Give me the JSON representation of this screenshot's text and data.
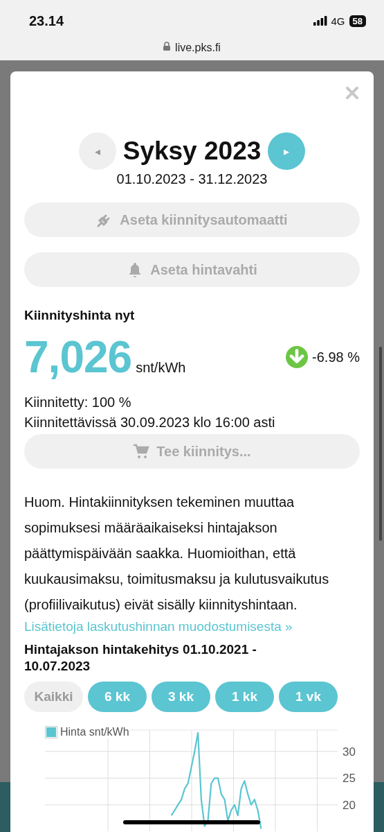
{
  "status_bar": {
    "time": "23.14",
    "network": "4G",
    "battery": "58"
  },
  "address_bar": {
    "url": "live.pks.fi"
  },
  "modal": {
    "period": {
      "title": "Syksy 2023",
      "dates": "01.10.2023 - 31.12.2023",
      "prev": {
        "label": "◂",
        "disabled": true
      },
      "next": {
        "label": "▸",
        "disabled": false
      }
    },
    "actions": [
      {
        "kind": "plug",
        "label": "Aseta kiinnitysautomaatti",
        "disabled": true
      },
      {
        "kind": "bell",
        "label": "Aseta hintavahti",
        "disabled": true
      }
    ],
    "price": {
      "heading": "Kiinnityshinta nyt",
      "value": "7,026",
      "unit": "snt/kWh",
      "decreasing": true,
      "change": "-6.98 %"
    },
    "fixed": "Kiinnitetty: 100 %",
    "deadline": "Kiinnitettävissä 30.09.2023 klo 16:00 asti",
    "order_button": {
      "kind": "cart",
      "label": "Tee kiinnitys...",
      "disabled": true
    },
    "notice": "Huom. Hintakiinnityksen tekeminen muuttaa sopimuksesi määräaikaiseksi hintajakson päättymispäivään saakka. Huomioithan, että kuukausimaksu, toimitusmaksu ja kulutusvaikutus (profiilivaikutus) eivät sisälly kiinnityshintaan.",
    "link": "Lisätietoja laskutushinnan muodostumisesta »",
    "chart_heading": "Hintajakson hintakehitys 01.10.2021 - 10.07.2023",
    "ranges": [
      {
        "label": "Kaikki",
        "selected": true
      },
      {
        "label": "6 kk",
        "selected": false
      },
      {
        "label": "3 kk",
        "selected": false
      },
      {
        "label": "1 kk",
        "selected": false
      },
      {
        "label": "1 vk",
        "selected": false
      }
    ],
    "chart_data": {
      "type": "line",
      "grid": true,
      "ylim": [
        15,
        34
      ],
      "yticks": [
        20,
        25,
        30
      ],
      "categories": [
        null,
        null,
        null,
        null,
        null,
        null,
        null,
        null,
        null,
        null,
        null,
        null,
        null,
        null,
        null,
        null,
        null,
        null,
        null,
        null,
        null,
        null,
        null,
        null,
        null,
        null,
        null,
        null,
        null,
        null,
        null,
        null,
        null,
        null,
        null,
        null,
        null,
        null,
        null,
        null,
        null,
        null,
        null,
        null,
        null,
        null,
        null,
        null,
        null,
        null,
        null,
        null,
        null,
        null,
        null,
        null,
        null,
        null,
        null,
        null,
        null,
        null,
        null,
        null,
        null,
        null,
        null,
        null,
        null,
        null,
        null,
        null,
        null,
        null,
        null,
        null,
        null,
        null,
        null,
        null,
        null,
        null,
        null,
        null,
        null,
        null,
        null,
        null,
        null
      ],
      "series": [
        {
          "name": "Hinta snt/kWh",
          "color": "#5bc5d1",
          "values": [
            null,
            null,
            null,
            null,
            null,
            null,
            null,
            null,
            null,
            null,
            null,
            null,
            null,
            null,
            null,
            null,
            null,
            null,
            null,
            null,
            null,
            null,
            null,
            null,
            null,
            null,
            null,
            null,
            null,
            null,
            null,
            null,
            null,
            null,
            null,
            null,
            null,
            null,
            18,
            19,
            20,
            21,
            23,
            24,
            27,
            30,
            33.5,
            21,
            16,
            17,
            24,
            25,
            25,
            22,
            21,
            17,
            19,
            20,
            18,
            23,
            24.5,
            22,
            20,
            21,
            19,
            15.5,
            null,
            null,
            null,
            null,
            null,
            null,
            null,
            null,
            null,
            null,
            null,
            null,
            null,
            null,
            null,
            null,
            null,
            null,
            null,
            null,
            null,
            null,
            null
          ]
        }
      ]
    }
  }
}
